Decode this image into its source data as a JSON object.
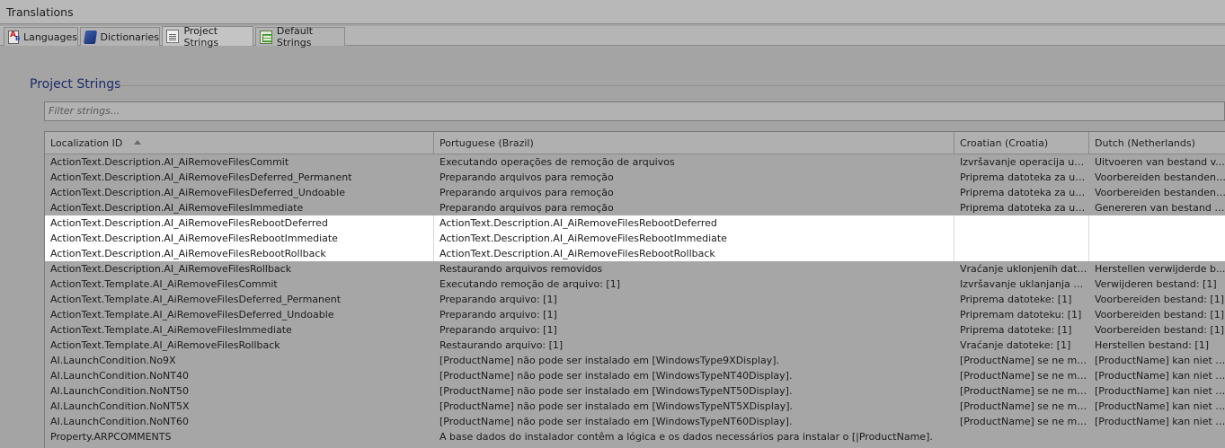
{
  "window": {
    "title": "Translations"
  },
  "tabs": [
    {
      "label": "Languages",
      "icon": "languages-icon",
      "active": false
    },
    {
      "label": "Dictionaries",
      "icon": "dictionary-book-icon",
      "active": false
    },
    {
      "label": "Project Strings",
      "icon": "document-icon",
      "active": true
    },
    {
      "label": "Default Strings",
      "icon": "spreadsheet-icon",
      "active": false
    }
  ],
  "section": {
    "title": "Project Strings"
  },
  "filter": {
    "placeholder": "Filter strings..."
  },
  "columns": [
    "Localization ID",
    "Portuguese (Brazil)",
    "Croatian (Croatia)",
    "Dutch (Netherlands)"
  ],
  "rows": [
    [
      "ActionText.Description.AI_AiRemoveFilesCommit",
      "Executando operações de remoção de arquivos",
      "Izvršavanje operacija ukl...",
      "Uitvoeren van bestand v..."
    ],
    [
      "ActionText.Description.AI_AiRemoveFilesDeferred_Permanent",
      "Preparando arquivos para remoção",
      "Priprema datoteka za ukla...",
      "Voorbereiden bestanden ..."
    ],
    [
      "ActionText.Description.AI_AiRemoveFilesDeferred_Undoable",
      "Preparando arquivos para remoção",
      "Priprema datoteka za ukla...",
      "Voorbereiden bestanden ..."
    ],
    [
      "ActionText.Description.AI_AiRemoveFilesImmediate",
      "Preparando arquivos para remoção",
      "Priprema datoteka za ukla...",
      "Genereren van bestand v..."
    ],
    [
      "ActionText.Description.AI_AiRemoveFilesRebootDeferred",
      "ActionText.Description.AI_AiRemoveFilesRebootDeferred",
      "",
      ""
    ],
    [
      "ActionText.Description.AI_AiRemoveFilesRebootImmediate",
      "ActionText.Description.AI_AiRemoveFilesRebootImmediate",
      "",
      ""
    ],
    [
      "ActionText.Description.AI_AiRemoveFilesRebootRollback",
      "ActionText.Description.AI_AiRemoveFilesRebootRollback",
      "",
      ""
    ],
    [
      "ActionText.Description.AI_AiRemoveFilesRollback",
      "Restaurando arquivos removidos",
      "Vraćanje uklonjenih datot...",
      "Herstellen verwijderde b..."
    ],
    [
      "ActionText.Template.AI_AiRemoveFilesCommit",
      "Executando remoção de arquivo: [1]",
      "Izvršavanje uklanjanja da...",
      "Verwijderen bestand: [1]"
    ],
    [
      "ActionText.Template.AI_AiRemoveFilesDeferred_Permanent",
      "Preparando arquivo: [1]",
      "Priprema datoteke: [1]",
      "Voorbereiden bestand: [1]"
    ],
    [
      "ActionText.Template.AI_AiRemoveFilesDeferred_Undoable",
      "Preparando arquivo: [1]",
      "Pripremam datoteku: [1]",
      "Voorbereiden bestand: [1]"
    ],
    [
      "ActionText.Template.AI_AiRemoveFilesImmediate",
      "Preparando arquivo: [1]",
      "Priprema datoteke: [1]",
      "Voorbereiden bestand: [1]"
    ],
    [
      "ActionText.Template.AI_AiRemoveFilesRollback",
      "Restaurando arquivo: [1]",
      "Vraćanje datoteke: [1]",
      "Herstellen bestand: [1]"
    ],
    [
      "AI.LaunchCondition.No9X",
      "[ProductName] não pode ser instalado em [WindowsType9XDisplay].",
      "[ProductName] se ne mož...",
      "[ProductName] kan niet w..."
    ],
    [
      "AI.LaunchCondition.NoNT40",
      "[ProductName] não pode ser instalado em [WindowsTypeNT40Display].",
      "[ProductName] se ne mož...",
      "[ProductName] kan niet w..."
    ],
    [
      "AI.LaunchCondition.NoNT50",
      "[ProductName] não pode ser instalado em [WindowsTypeNT50Display].",
      "[ProductName] se ne mož...",
      "[ProductName] kan niet w..."
    ],
    [
      "AI.LaunchCondition.NoNT5X",
      "[ProductName] não pode ser instalado em [WindowsTypeNT5XDisplay].",
      "[ProductName] se ne mož...",
      "[ProductName] kan niet w..."
    ],
    [
      "AI.LaunchCondition.NoNT60",
      "[ProductName] não pode ser instalado em [WindowsTypeNT60Display].",
      "[ProductName] se ne mož...",
      "[ProductName] kan niet w..."
    ],
    [
      "Property.ARPCOMMENTS",
      "A base dados do instalador contêm a lógica e os dados necessários para instalar o [|ProductName].",
      "",
      ""
    ]
  ],
  "selected_rows": [
    4,
    5,
    6
  ]
}
